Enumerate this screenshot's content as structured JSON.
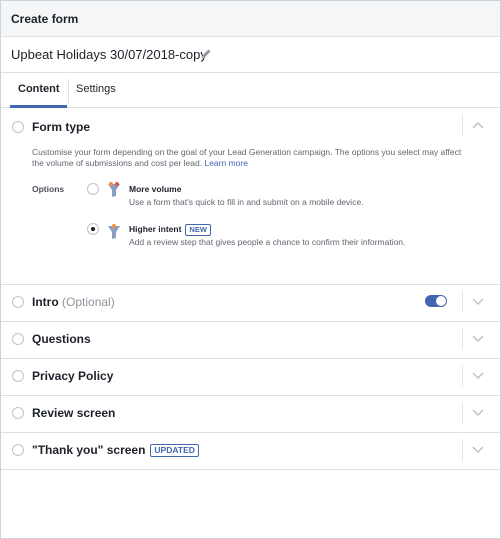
{
  "dialog": {
    "title": "Create form"
  },
  "form": {
    "name": "Upbeat Holidays 30/07/2018-copy"
  },
  "tabs": [
    {
      "label": "Content",
      "active": true
    },
    {
      "label": "Settings",
      "active": false
    }
  ],
  "form_type": {
    "title": "Form type",
    "description": "Customise your form depending on the goal of your Lead Generation campaign. The options you select may affect the volume of submissions and cost per lead.",
    "learn_more": "Learn more",
    "options_label": "Options",
    "options": [
      {
        "title": "More volume",
        "subtitle": "Use a form that's quick to fill in and submit on a mobile device.",
        "selected": false,
        "badge": ""
      },
      {
        "title": "Higher intent",
        "subtitle": "Add a review step that gives people a chance to confirm their information.",
        "selected": true,
        "badge": "NEW"
      }
    ]
  },
  "sections": [
    {
      "title": "Intro",
      "optional": "(Optional)",
      "toggle_on": true,
      "badge": ""
    },
    {
      "title": "Questions",
      "optional": "",
      "badge": ""
    },
    {
      "title": "Privacy Policy",
      "optional": "",
      "badge": ""
    },
    {
      "title": "Review screen",
      "optional": "",
      "badge": ""
    },
    {
      "title": "\"Thank you\" screen",
      "optional": "",
      "badge": "UPDATED"
    }
  ],
  "colors": {
    "accent": "#4267b2",
    "text": "#1d2129",
    "muted": "#606770",
    "border": "#dddfe2"
  },
  "icons": [
    "pencil-icon",
    "chevron-up-icon",
    "chevron-down-icon",
    "funnel-icon",
    "toggle-switch"
  ]
}
